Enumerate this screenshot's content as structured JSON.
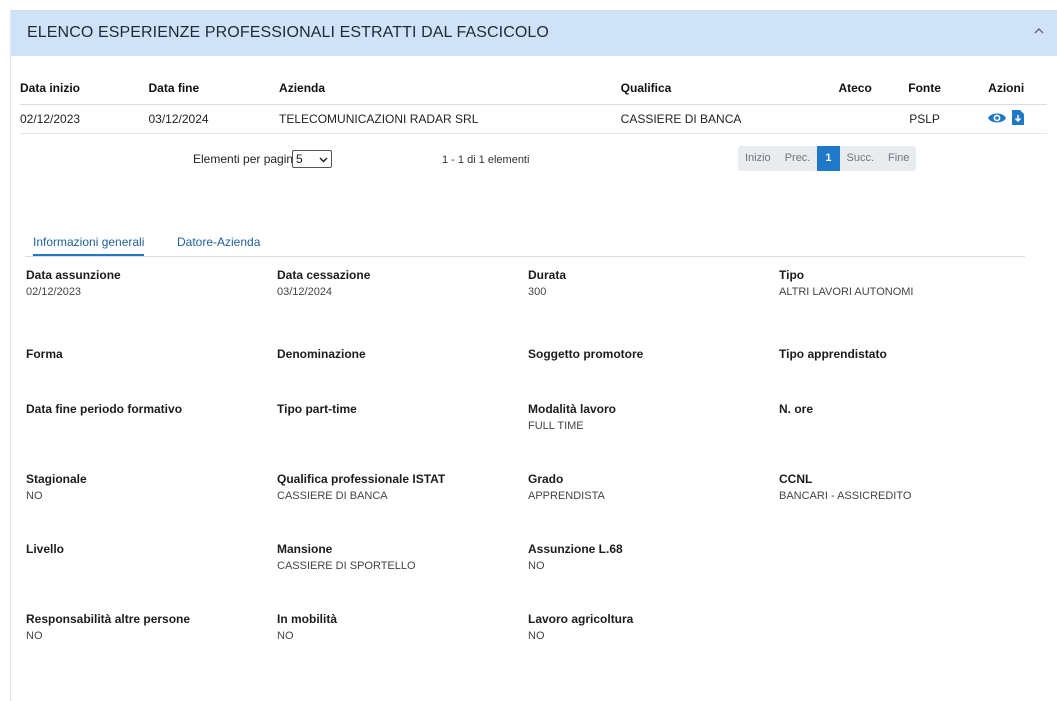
{
  "header": {
    "title": "ELENCO ESPERIENZE PROFESSIONALI ESTRATTI DAL FASCICOLO",
    "collapse_icon": "chevron-up-icon"
  },
  "table": {
    "columns": [
      "Data inizio",
      "Data fine",
      "Azienda",
      "Qualifica",
      "Ateco",
      "Fonte",
      "Azioni"
    ],
    "rows": [
      {
        "data_inizio": "02/12/2023",
        "data_fine": "03/12/2024",
        "azienda": "TELECOMUNICAZIONI RADAR SRL",
        "qualifica": "CASSIERE DI BANCA",
        "ateco": "",
        "fonte": "PSLP",
        "actions": [
          "eye-icon",
          "download-icon"
        ]
      }
    ]
  },
  "pager": {
    "label": "Elementi per pagina",
    "page_size": "5",
    "count_text": "1 - 1 di 1 elementi",
    "buttons": [
      "Inizio",
      "Prec.",
      "1",
      "Succ.",
      "Fine"
    ],
    "active_page": "1"
  },
  "tabs": [
    {
      "label": "Informazioni generali",
      "active": true
    },
    {
      "label": "Datore-Azienda",
      "active": false
    }
  ],
  "details": [
    [
      {
        "label": "Data assunzione",
        "value": "02/12/2023"
      },
      {
        "label": "Data cessazione",
        "value": "03/12/2024"
      },
      {
        "label": "Durata",
        "value": "300"
      },
      {
        "label": "Tipo",
        "value": "ALTRI LAVORI AUTONOMI"
      }
    ],
    [
      {
        "label": "Forma",
        "value": ""
      },
      {
        "label": "Denominazione",
        "value": ""
      },
      {
        "label": "Soggetto promotore",
        "value": ""
      },
      {
        "label": "Tipo apprendistato",
        "value": ""
      }
    ],
    [
      {
        "label": "Data fine periodo formativo",
        "value": ""
      },
      {
        "label": "Tipo part-time",
        "value": ""
      },
      {
        "label": "Modalità lavoro",
        "value": "FULL TIME"
      },
      {
        "label": "N. ore",
        "value": ""
      }
    ],
    [
      {
        "label": "Stagionale",
        "value": "NO"
      },
      {
        "label": "Qualifica professionale ISTAT",
        "value": "CASSIERE DI BANCA"
      },
      {
        "label": "Grado",
        "value": "APPRENDISTA"
      },
      {
        "label": "CCNL",
        "value": "BANCARI - ASSICREDITO"
      }
    ],
    [
      {
        "label": "Livello",
        "value": ""
      },
      {
        "label": "Mansione",
        "value": "CASSIERE DI SPORTELLO"
      },
      {
        "label": "Assunzione L.68",
        "value": "NO"
      }
    ],
    [
      {
        "label": "Responsabilità altre persone",
        "value": "NO"
      },
      {
        "label": "In mobilità",
        "value": "NO"
      },
      {
        "label": "Lavoro agricoltura",
        "value": "NO"
      }
    ]
  ],
  "colors": {
    "header_bg": "#cfe2f7",
    "accent": "#1f78c8",
    "tab_text": "#1f5f99"
  }
}
